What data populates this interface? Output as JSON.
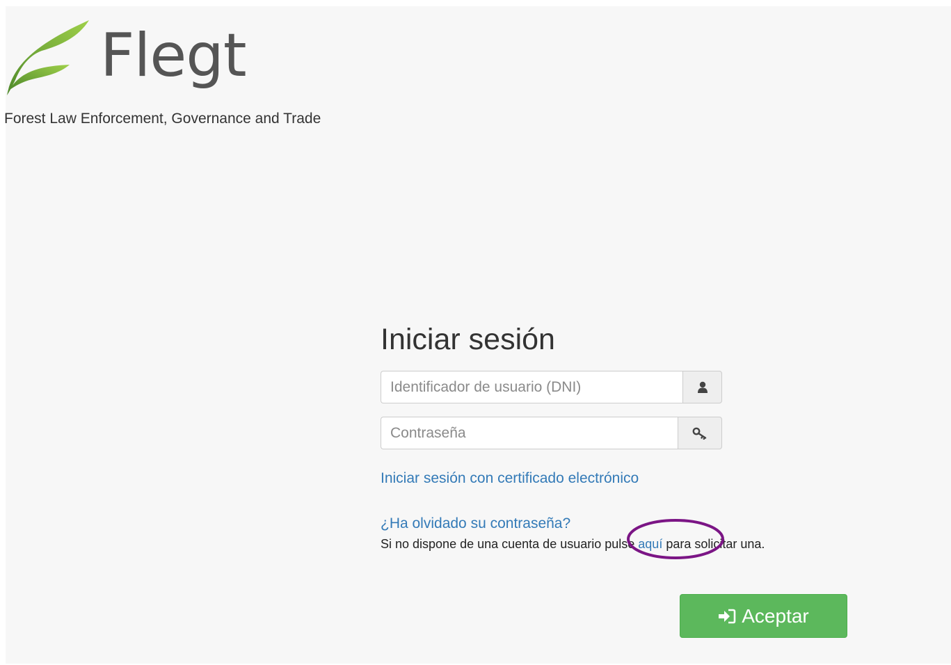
{
  "header": {
    "logo_text": "Flegt",
    "tagline": "Forest Law Enforcement, Governance and Trade"
  },
  "login": {
    "title": "Iniciar sesión",
    "user_placeholder": "Identificador de usuario (DNI)",
    "password_placeholder": "Contraseña",
    "certificate_link": "Iniciar sesión con certificado electrónico",
    "forgot_link": "¿Ha olvidado su contraseña?",
    "no_account_prefix": "Si no dispone de una cuenta de usuario pulse ",
    "no_account_link": "aquí",
    "no_account_suffix": " para solicitar una.",
    "submit_label": "Aceptar",
    "user_icon": "user-icon",
    "password_icon": "key-icon",
    "submit_icon": "sign-in-icon"
  },
  "colors": {
    "link": "#337ab7",
    "button": "#5cb85c",
    "annotation": "#7b1585",
    "logo_green": "#7ab648"
  }
}
